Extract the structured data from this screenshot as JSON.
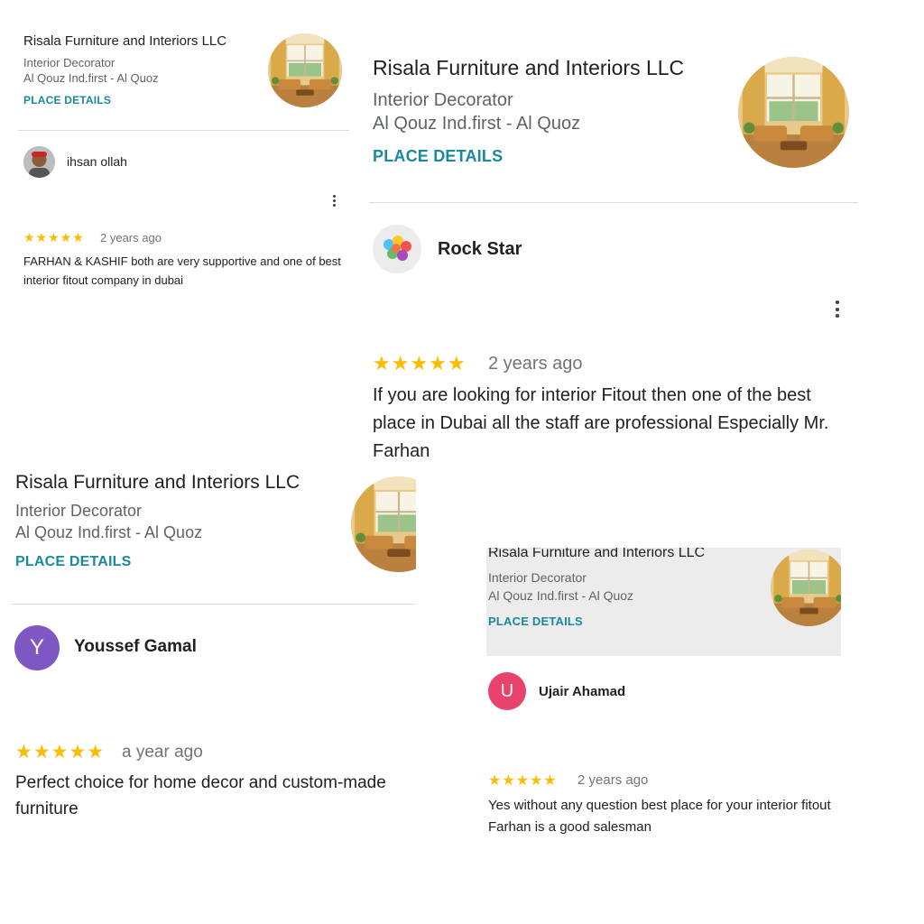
{
  "colors": {
    "accent": "#1a8a99",
    "star": "#fbbc04",
    "avatar_purple": "#7e57c2",
    "avatar_pink": "#e8436b"
  },
  "cards": [
    {
      "place": {
        "name": "Risala Furniture and Interiors LLC",
        "category": "Interior Decorator",
        "address": "Al Qouz Ind.first - Al Quoz",
        "details_label": "PLACE DETAILS"
      },
      "review": {
        "author": "ihsan ollah",
        "stars": "★★★★★",
        "rating": 5,
        "age": "2 years ago",
        "text": "FARHAN & KASHIF both are very supportive and one of best interior fitout company in dubai",
        "avatar_icon": "photo-avatar"
      }
    },
    {
      "place": {
        "name": "Risala Furniture and Interiors LLC",
        "category": "Interior Decorator",
        "address": "Al Qouz Ind.first - Al Quoz",
        "details_label": "PLACE DETAILS"
      },
      "review": {
        "author": "Rock Star",
        "stars": "★★★★★",
        "rating": 5,
        "age": "2 years ago",
        "text": "If you are looking for interior Fitout then one of the best place in Dubai all the staff are professional Especially Mr. Farhan",
        "avatar_icon": "colorful-balls-avatar"
      }
    },
    {
      "place": {
        "name": "Risala Furniture and Interiors LLC",
        "category": "Interior Decorator",
        "address": "Al Qouz Ind.first - Al Quoz",
        "details_label": "PLACE DETAILS"
      },
      "review": {
        "author": "Youssef Gamal",
        "initial": "Y",
        "stars": "★★★★★",
        "rating": 5,
        "age": "a year ago",
        "text": "Perfect choice for home decor and custom-made furniture"
      }
    },
    {
      "place": {
        "name": "Risala Furniture and Interiors LLC",
        "category": "Interior Decorator",
        "address": "Al Qouz Ind.first - Al Quoz",
        "details_label": "PLACE DETAILS"
      },
      "review": {
        "author": "Ujair Ahamad",
        "initial": "U",
        "stars": "★★★★★",
        "rating": 5,
        "age": "2 years ago",
        "text": "Yes without any question best place for your interior fitout Farhan is a good salesman"
      }
    }
  ]
}
